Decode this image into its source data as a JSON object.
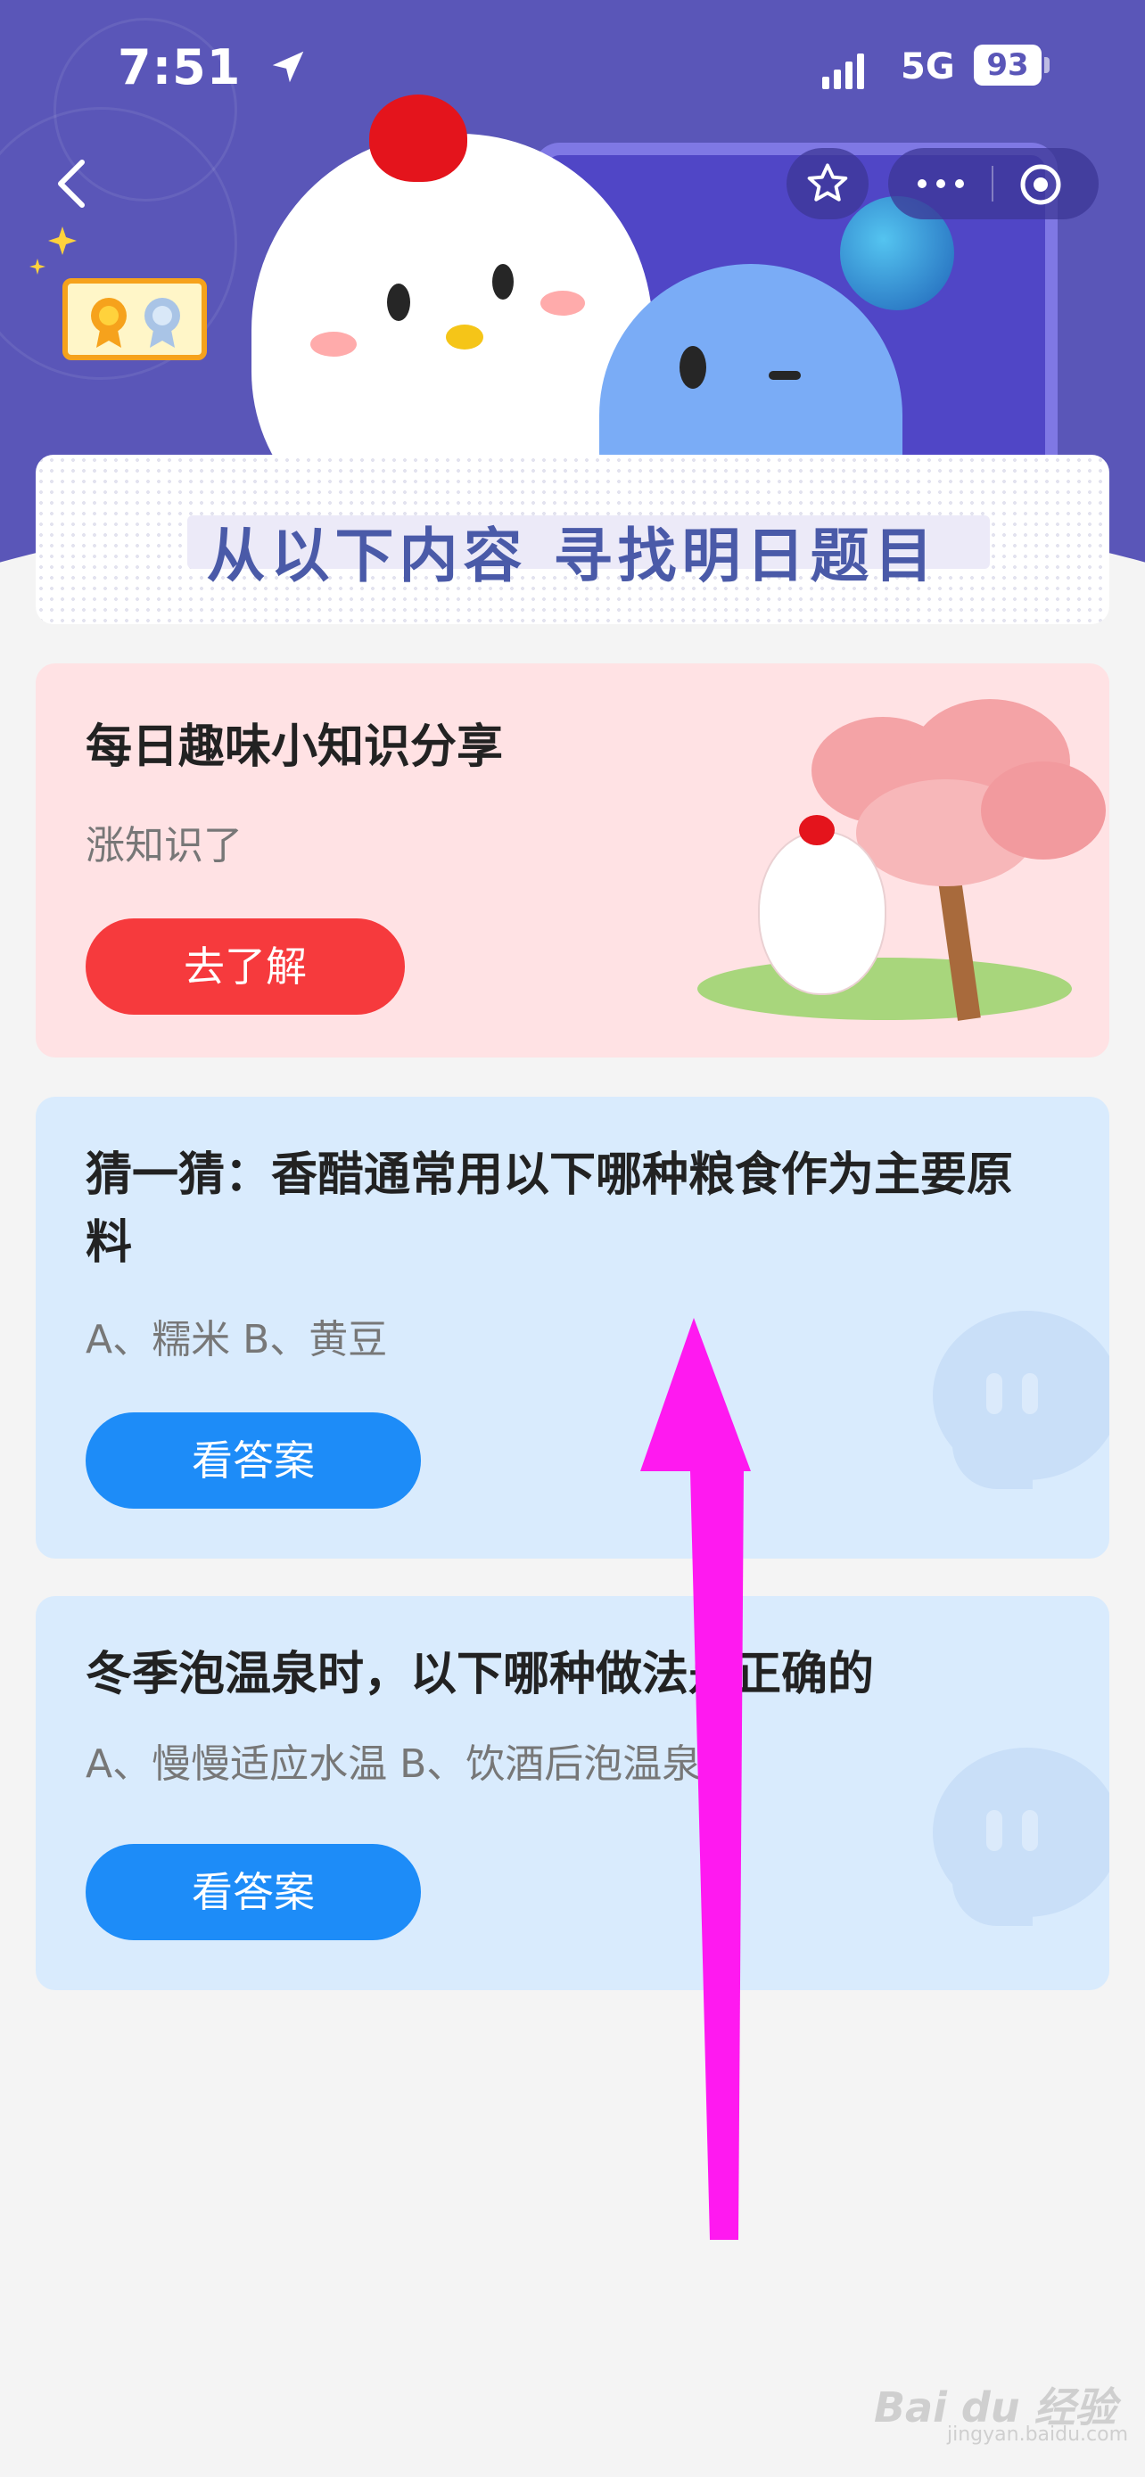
{
  "status_bar": {
    "time": "7:51",
    "network": "5G",
    "battery": "93",
    "location_icon": "location-arrow-icon",
    "signal_icon": "signal-bars-icon"
  },
  "nav": {
    "back_icon": "chevron-left-icon",
    "favorite_icon": "star-icon",
    "more_icon": "more-dots-icon",
    "close_icon": "record-circle-icon"
  },
  "banner": {
    "title": "从以下内容 寻找明日题目"
  },
  "cards": [
    {
      "title": "每日趣味小知识分享",
      "subtitle": "涨知识了",
      "button": "去了解"
    },
    {
      "title": "猜一猜：香醋通常用以下哪种粮食作为主要原料",
      "options": "A、糯米    B、黄豆",
      "button": "看答案"
    },
    {
      "title": "冬季泡温泉时，以下哪种做法是正确的",
      "options": "A、慢慢适应水温    B、饮酒后泡温泉",
      "button": "看答案"
    }
  ],
  "colors": {
    "header": "#5a56b8",
    "pink_card": "#ffe2e4",
    "blue_card": "#d9ebfd",
    "red_button": "#f63a3d",
    "blue_button": "#1d8cf8",
    "arrow": "#ff19f0"
  },
  "watermark": {
    "brand": "Bai du 经验",
    "domain": "jingyan.baidu.com"
  }
}
